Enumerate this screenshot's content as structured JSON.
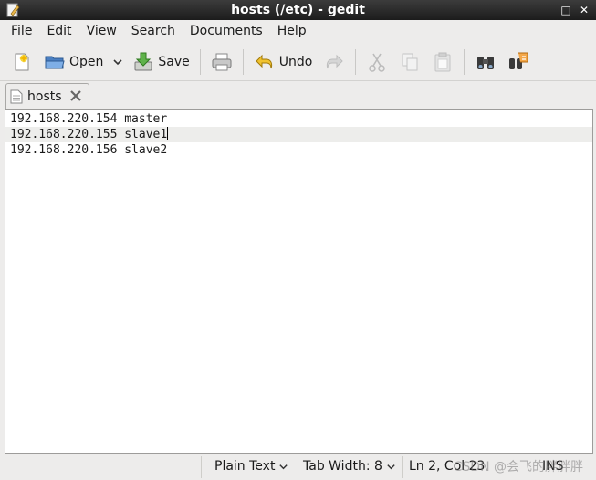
{
  "window": {
    "title": "hosts (/etc) - gedit",
    "min": "_",
    "max": "□",
    "close": "✕"
  },
  "menu": [
    "File",
    "Edit",
    "View",
    "Search",
    "Documents",
    "Help"
  ],
  "toolbar": {
    "open": "Open",
    "save": "Save",
    "undo": "Undo"
  },
  "tab": {
    "label": "hosts"
  },
  "editor": {
    "lines": [
      "192.168.220.154 master",
      "192.168.220.155 slave1",
      "192.168.220.156 slave2"
    ],
    "current_line": 2
  },
  "status": {
    "language": "Plain Text",
    "tab_width": "Tab Width: 8",
    "position": "Ln 2, Col 23",
    "mode": "INS",
    "watermark": "CSDN @会飞的胖胖胖"
  }
}
